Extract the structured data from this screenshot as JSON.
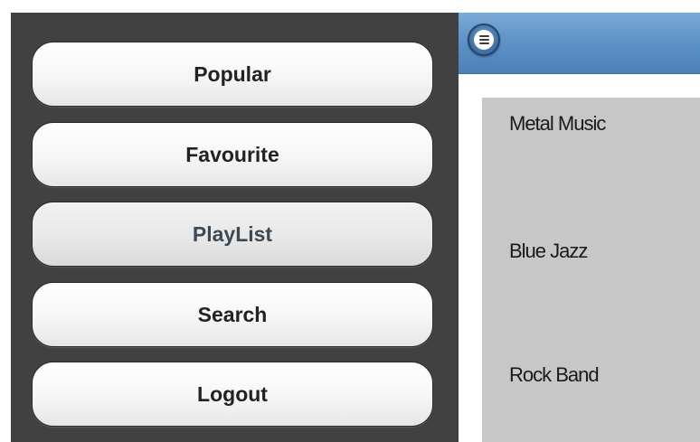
{
  "sidebar": {
    "items": [
      {
        "label": "Popular"
      },
      {
        "label": "Favourite"
      },
      {
        "label": "PlayList",
        "active": true
      },
      {
        "label": "Search"
      },
      {
        "label": "Logout"
      }
    ]
  },
  "header": {
    "menu_icon": "menu-icon"
  },
  "content": {
    "items": [
      {
        "label": "Metal Music"
      },
      {
        "label": "Blue Jazz"
      },
      {
        "label": "Rock Band"
      }
    ]
  },
  "colors": {
    "sidebar_bg": "#414141",
    "header_blue": "#5d92c6",
    "list_bg": "#c7c7c7",
    "active_text": "#3d4a56"
  }
}
